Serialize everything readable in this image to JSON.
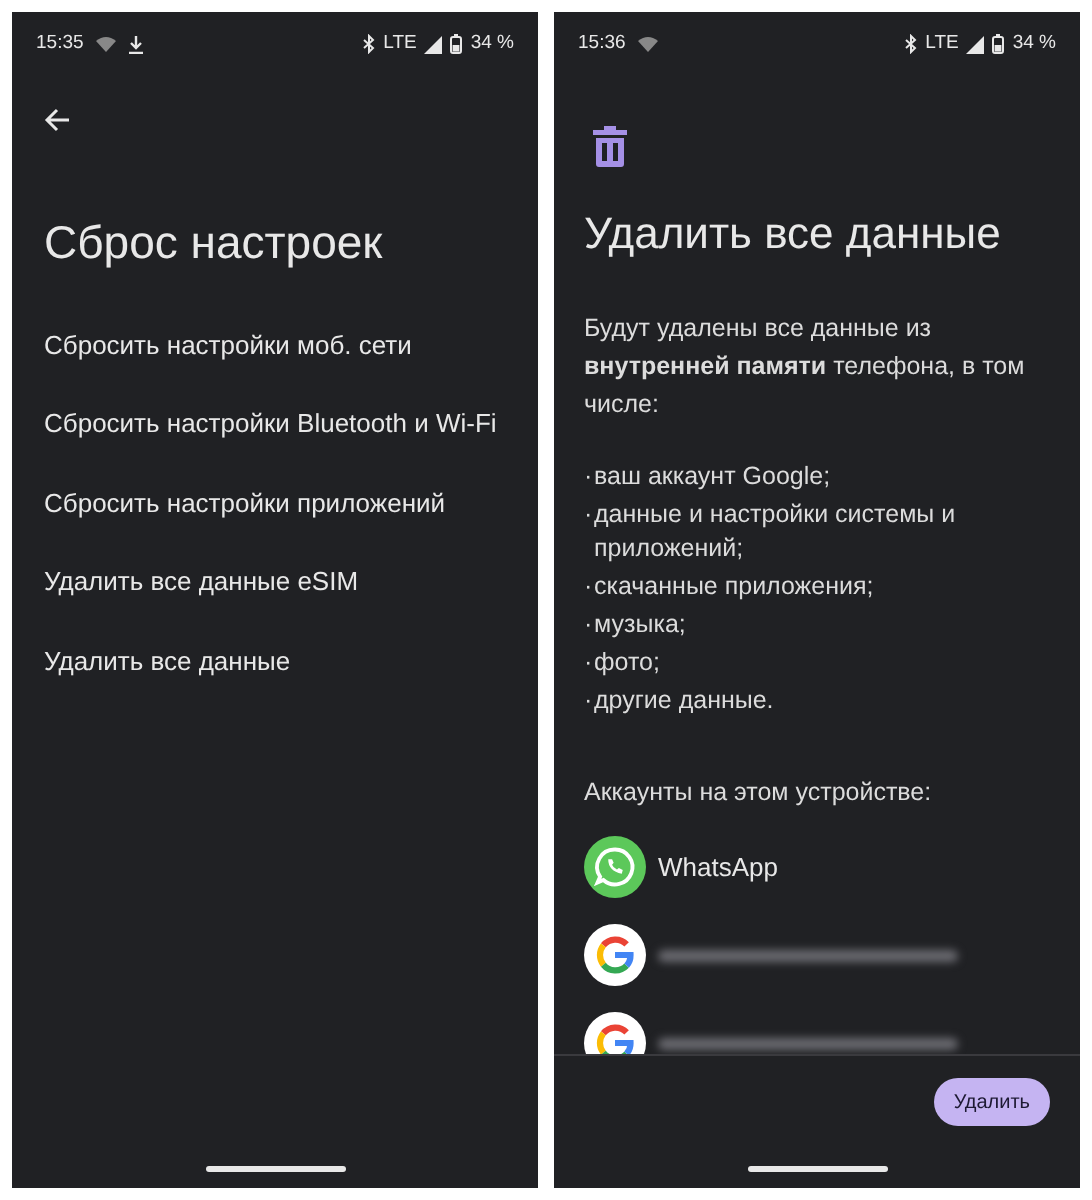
{
  "left_screen": {
    "status_bar": {
      "time": "15:35",
      "download": true,
      "network": "LTE",
      "battery": "34 %"
    },
    "title": "Сброс настроек",
    "items": [
      "Сбросить настройки моб. сети",
      "Сбросить настройки Bluetooth и Wi-Fi",
      "Сбросить настройки приложений",
      "Удалить все данные eSIM",
      "Удалить все данные"
    ]
  },
  "right_screen": {
    "status_bar": {
      "time": "15:36",
      "download": false,
      "network": "LTE",
      "battery": "34 %"
    },
    "title": "Удалить все данные",
    "description": "Будут удалены все данные из **внутренней памяти** телефона, в том числе:",
    "list": [
      {
        "marker": "·",
        "text": "ваш аккаунт Google;"
      },
      {
        "marker": "·",
        "text": "данные и настройки системы и приложений;"
      },
      {
        "marker": "·",
        "text": "скачанные приложения;"
      },
      {
        "marker": "·",
        "text": "музыка;"
      },
      {
        "marker": "·",
        "text": "фото;"
      },
      {
        "marker": "·",
        "text": "другие данные."
      }
    ],
    "accounts_heading": "Аккаунты на этом устройстве:",
    "accounts": [
      {
        "kind": "whatsapp",
        "name": "WhatsApp"
      },
      {
        "kind": "google"
      },
      {
        "kind": "google"
      }
    ],
    "button": "Удалить"
  }
}
